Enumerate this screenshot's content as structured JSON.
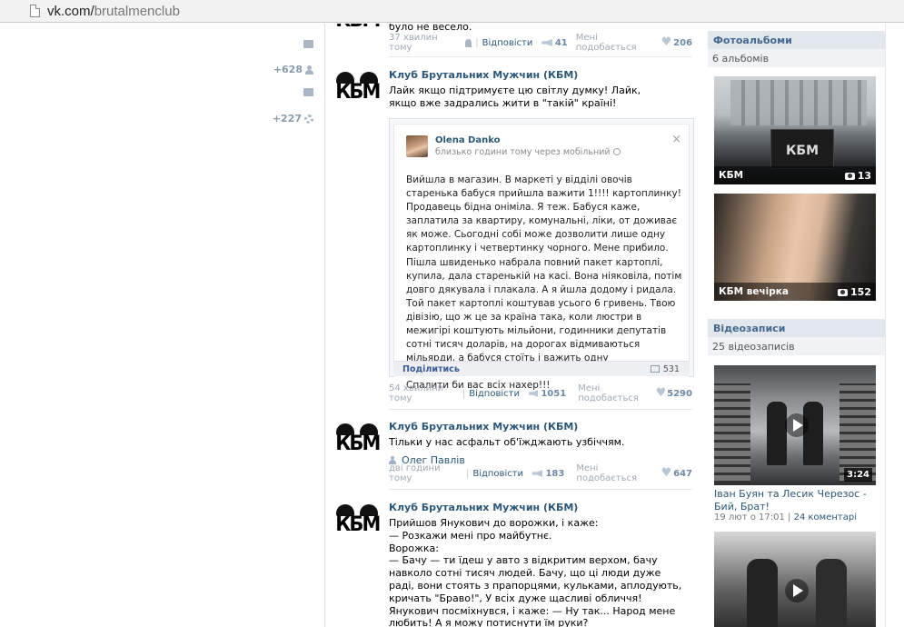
{
  "browser": {
    "url_host": "vk.com/",
    "url_path": "brutalmenclub"
  },
  "left_panel": {
    "stat_likes": "+628",
    "stat_members": "+227"
  },
  "feed": {
    "top_fragment": {
      "text": "було не весело.",
      "time": "37 хвилин тому",
      "reply": "Відповісти",
      "shares": "41",
      "like_label": "Мені подобається",
      "likes": "206"
    },
    "posts": [
      {
        "author": "Клуб Брутальних Мужчин (КБМ)",
        "logo": "КБМ",
        "text": "Лайк якщо підтримуєте цю світлу думку! Лайк, якщо вже задрались жити в \"такій\" країні!",
        "shared": {
          "name": "Olena Danko",
          "time": "близько години тому через мобільний",
          "close": "×",
          "text": "Вийшла в магазин. В маркеті у відділі овочів старенька бабуся прийшла важити 1!!!! картоплинку! Продавець бідна оніміла. Я теж. Бабуся каже, заплатила за квартиру, комунальні, ліки, от доживає як може. Сьогодні собі може дозволити лише одну картоплинку і четвертинку чорного. Мене прибило. Пішла швиденько набрала повний пакет картоплі, купила, дала старенькій на касі. Вона ніяковіла, потім довго дякувала і плакала. А я йшла додому і ридала. Той пакет картоплі коштував усього 6 гривень. Твою дівізію, що ж це за країна така, коли люстри в межигірі коштують мільйони, годинники депутатів сотні тисяч доларів, на дорогах відмиваються мільярди, а бабуся стоїть і важить одну картоплинку?????? Де курва ваше пАкращення???? Спалити би вас всіх нахер!!!",
          "share_label": "Поділитись",
          "comments": "531"
        },
        "time": "54 хвилини тому",
        "reply": "Відповісти",
        "shares": "1051",
        "like_label": "Мені подобається",
        "likes": "5290"
      },
      {
        "author": "Клуб Брутальних Мужчин (КБМ)",
        "logo": "КБМ",
        "text": "Тільки у нас асфальт об'їжджають узбіччям.",
        "signer": "Олег Павлів",
        "time": "дві години тому",
        "reply": "Відповісти",
        "shares": "183",
        "like_label": "Мені подобається",
        "likes": "647"
      },
      {
        "author": "Клуб Брутальних Мужчин (КБМ)",
        "logo": "КБМ",
        "lines": [
          "Прийшов Янукович до ворожки, і каже:",
          "— Розкажи мені про майбутнє.",
          "Ворожка:",
          "— Бачу — ти їдеш у авто з відкритим верхом, бачу навколо сотні тисяч людей. Бачу, що ці люди дуже раді, вони стоять з прапорцями, кульками, аплодують, кричать \"Браво!\", У всіх дуже щасливі обличчя!",
          "Янукович посміхнувся, і каже: — Ну так... Народ мене любить! А я можу потиснути їм руки?"
        ]
      }
    ]
  },
  "sidebar": {
    "albums": {
      "heading": "Фотоальбоми",
      "count": "6 альбомів",
      "items": [
        {
          "title": "КБМ",
          "photos": "13"
        },
        {
          "title": "КБМ вечірка",
          "photos": "152"
        }
      ]
    },
    "videos": {
      "heading": "Відеозаписи",
      "count": "25 відеозаписів",
      "items": [
        {
          "duration": "3:24",
          "title": "Іван Буян та Лесик Черезос - Бий, Брат!",
          "date": "19 лют о 17:01",
          "sep": "|",
          "comments": "24 коментарі"
        },
        {
          "duration": ""
        }
      ]
    }
  }
}
